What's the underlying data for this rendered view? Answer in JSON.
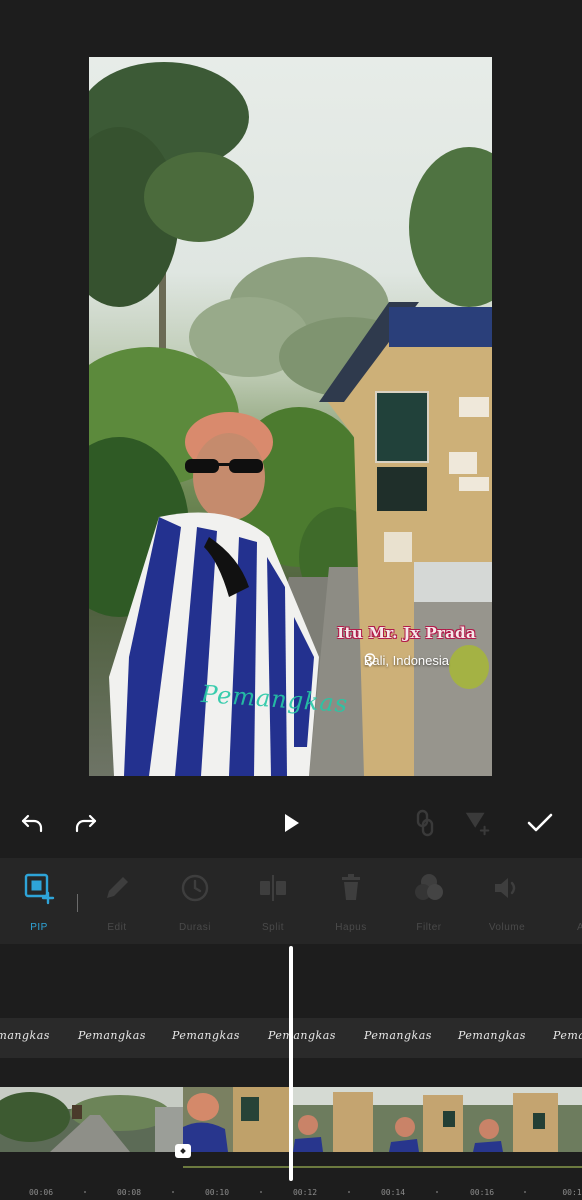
{
  "preview": {
    "title_overlay": "Itu Mr. Jx Prada",
    "location_overlay": "Bali, Indonesia",
    "watermark": "Pemangkas"
  },
  "controls": {
    "undo_icon": "undo-arrow",
    "redo_icon": "redo-arrow",
    "play_icon": "play-triangle",
    "keyframe_icon": "link",
    "add_keyframe_icon": "funnel-plus",
    "confirm_icon": "checkmark"
  },
  "toolbar": {
    "items": [
      {
        "label": "PIP",
        "icon": "pip-add",
        "active": true
      },
      {
        "label": "Edit",
        "icon": "pencil",
        "active": false
      },
      {
        "label": "Durasi",
        "icon": "clock",
        "active": false
      },
      {
        "label": "Split",
        "icon": "split",
        "active": false
      },
      {
        "label": "Hapus",
        "icon": "trash",
        "active": false
      },
      {
        "label": "Filter",
        "icon": "filter-circles",
        "active": false
      },
      {
        "label": "Volume",
        "icon": "speaker",
        "active": false
      },
      {
        "label": "Ani",
        "icon": "animation",
        "active": false
      }
    ],
    "accent": "#2ea4d8"
  },
  "timeline": {
    "watermark_clip_text": "Pemangkas",
    "ticks": [
      "00:06",
      "00:08",
      "00:10",
      "00:12",
      "00:14",
      "00:16",
      "00:1"
    ]
  }
}
